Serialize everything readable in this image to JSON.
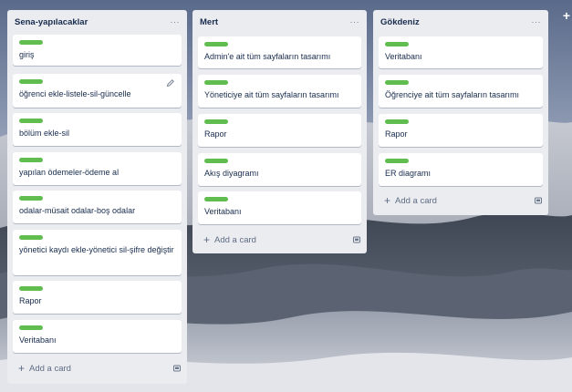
{
  "lists": [
    {
      "title": "Sena-yapılacaklar",
      "menu": "···",
      "cards": [
        {
          "title": "giriş"
        },
        {
          "title": "öğrenci ekle-listele-sil-güncelle"
        },
        {
          "title": "bölüm ekle-sil"
        },
        {
          "title": "yapılan ödemeler-ödeme al"
        },
        {
          "title": "odalar-müsait odalar-boş odalar"
        },
        {
          "title": "yönetici kaydı ekle-yönetici sil-şifre değiştir"
        },
        {
          "title": "Rapor"
        },
        {
          "title": "Veritabanı"
        }
      ],
      "add_card_label": "Add a card"
    },
    {
      "title": "Mert",
      "menu": "···",
      "cards": [
        {
          "title": "Admin'e ait tüm sayfaların tasarımı"
        },
        {
          "title": "Yöneticiye ait tüm sayfaların tasarımı"
        },
        {
          "title": "Rapor"
        },
        {
          "title": "Akış diyagramı"
        },
        {
          "title": "Veritabanı"
        }
      ],
      "add_card_label": "Add a card"
    },
    {
      "title": "Gökdeniz",
      "menu": "···",
      "cards": [
        {
          "title": "Veritabanı"
        },
        {
          "title": "Öğrenciye ait tüm sayfaların tasarımı"
        },
        {
          "title": "Rapor"
        },
        {
          "title": "ER diagramı"
        }
      ],
      "add_card_label": "Add a card"
    }
  ],
  "colors": {
    "label_green": "#61bd4f",
    "list_bg": "#ebecf0",
    "card_bg": "#ffffff",
    "text": "#172b4d",
    "muted": "#5e6c84"
  },
  "icons": {
    "list_menu": "ellipsis-icon",
    "card_edit": "pencil-icon",
    "add": "plus-icon",
    "template": "card-template-icon",
    "corner": "plus-icon"
  }
}
